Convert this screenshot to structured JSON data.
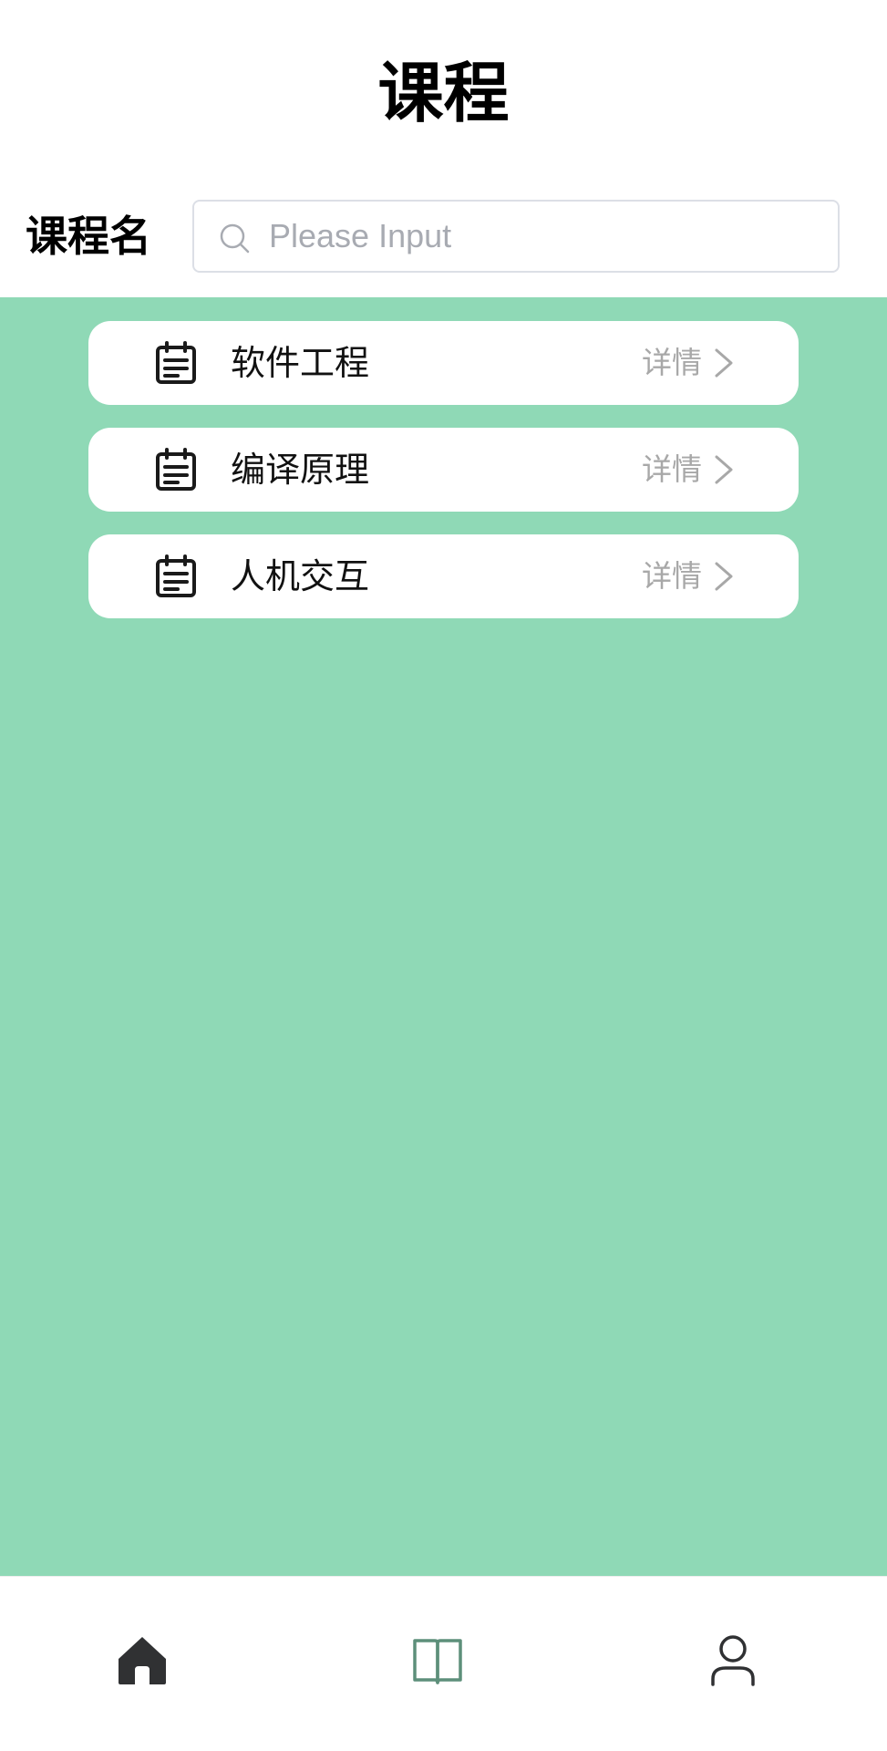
{
  "header": {
    "title": "课程"
  },
  "search": {
    "label": "课程名",
    "placeholder": "Please Input",
    "value": ""
  },
  "courses": [
    {
      "name": "软件工程",
      "detail_label": "详情",
      "icon": "calendar-note-icon"
    },
    {
      "name": "编译原理",
      "detail_label": "详情",
      "icon": "calendar-note-icon"
    },
    {
      "name": "人机交互",
      "detail_label": "详情",
      "icon": "calendar-note-icon"
    }
  ],
  "bottom_nav": {
    "items": [
      {
        "id": "home",
        "icon": "home-icon"
      },
      {
        "id": "courses",
        "icon": "book-open-icon",
        "active": true
      },
      {
        "id": "profile",
        "icon": "user-icon"
      }
    ]
  },
  "colors": {
    "content_background": "#8fd9b6",
    "active_nav": "#5d8f7a",
    "inactive_nav": "#303133"
  }
}
